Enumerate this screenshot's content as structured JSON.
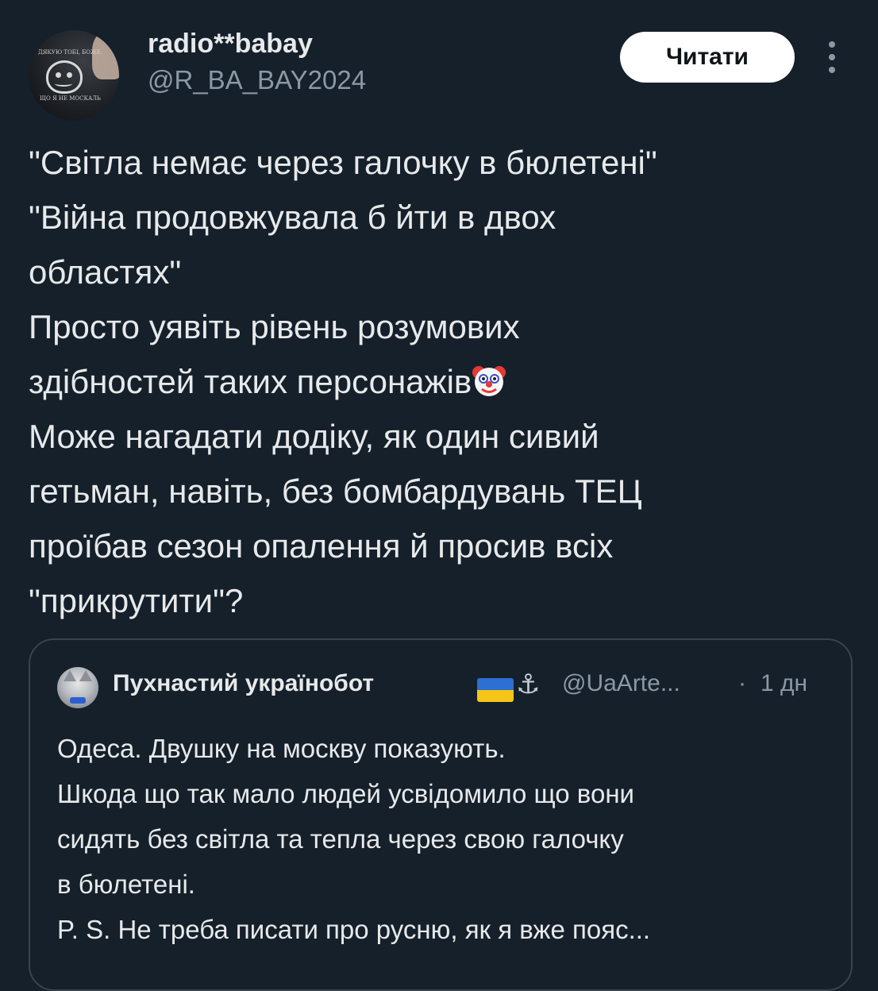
{
  "tweet": {
    "author": {
      "display_name": "radio**babay",
      "handle": "@R_BA_BAY2024",
      "avatar_text_1": "ДЯКУЮ ТОБІ, БОЖЕ,",
      "avatar_text_2": "ЩО Я НЕ МОСКАЛЬ"
    },
    "follow_label": "Читати",
    "more_icon": "more-vertical-icon",
    "text_lines": [
      "\"Світла немає через галочку в бюлетені\"",
      "\"Війна продовжувала б йти в двох",
      "областях\"",
      "Просто уявіть рівень розумових",
      "здібностей таких персонажів",
      "Може нагадати додіку, як один сивий",
      "гетьман, навіть, без бомбардувань ТЕЦ",
      "проїбав сезон опалення й просив всіх",
      "\"прикрутити\"?"
    ],
    "emoji": "clown-face"
  },
  "quote": {
    "display_name": "Пухнастий українобот",
    "flag": "ukraine-flag",
    "anchor_glyph": "⚓",
    "handle": "@UaArte...",
    "separator": "·",
    "time": "1 дн",
    "text_lines": [
      "Одеса. Двушку на москву показують.",
      "Шкода що так мало людей усвідомило що вони",
      "сидять без світла та тепла через свою галочку",
      "в бюлетені.",
      "P. S. Не треба писати про русню, як я вже пояс..."
    ],
    "colors": {
      "flag_blue": "#2d6fd2",
      "flag_yellow": "#f5c518"
    }
  },
  "theme": {
    "background": "#15202b",
    "text": "#e7e9ea",
    "secondary_text": "#8b98a5",
    "border": "#38444d"
  }
}
